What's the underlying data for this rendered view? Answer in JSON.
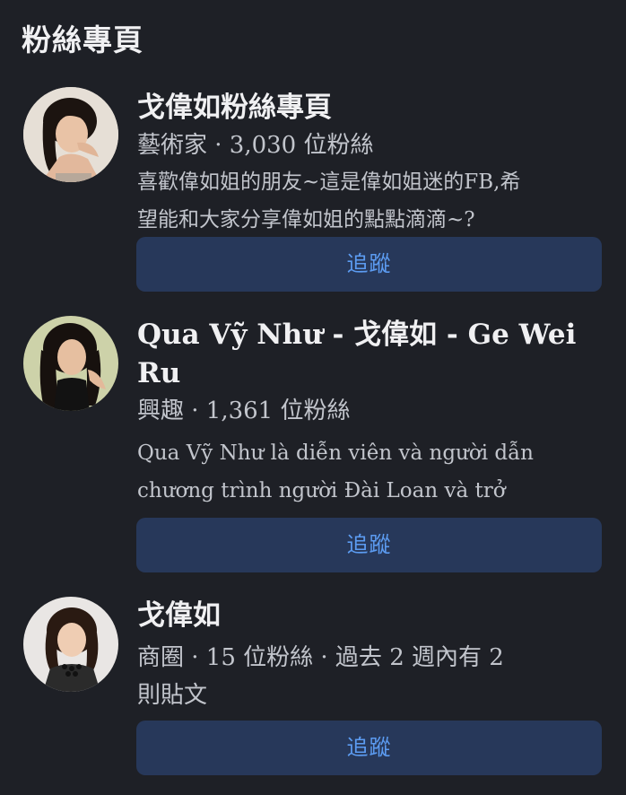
{
  "header": {
    "title": "粉絲專頁"
  },
  "pages": [
    {
      "name": "戈偉如粉絲專頁",
      "meta": "藝術家 · 3,030 位粉絲",
      "desc_line1": "喜歡偉如姐的朋友~這是偉如姐迷的FB,希",
      "desc_line2": "望能和大家分享偉如姐的點點滴滴~?",
      "follow_label": "追蹤",
      "avatar_icon": "profile-photo"
    },
    {
      "name_line1": "Qua Vỹ Như - 戈偉如 - Ge Wei",
      "name_line2": "Ru",
      "meta": "興趣 · 1,361 位粉絲",
      "desc_line1": "Qua Vỹ Như là diễn viên và người dẫn",
      "desc_line2": "chương trình người Đài Loan và trở",
      "follow_label": "追蹤",
      "avatar_icon": "profile-photo"
    },
    {
      "name": "戈偉如",
      "meta_line1": "商圈 · 15 位粉絲 · 過去 2 週內有 2",
      "meta_line2": "則貼文",
      "follow_label": "追蹤",
      "avatar_icon": "profile-photo"
    }
  ],
  "colors": {
    "background": "#1e2026",
    "button_bg": "#27385a",
    "button_text": "#5c9cf2",
    "secondary_text": "#c2c5cc"
  }
}
